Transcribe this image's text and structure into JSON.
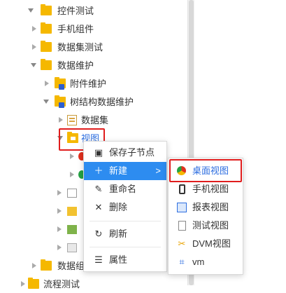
{
  "tree": {
    "items": [
      {
        "label": "控件测试",
        "state": "expanded"
      },
      {
        "label": "手机组件",
        "state": "collapsed"
      },
      {
        "label": "数据集测试",
        "state": "collapsed"
      },
      {
        "label": "数据维护",
        "state": "expanded"
      },
      {
        "label": "附件维护",
        "state": "collapsed"
      },
      {
        "label": "树结构数据维护",
        "state": "expanded"
      },
      {
        "label": "数据集",
        "state": "collapsed"
      },
      {
        "label": "视图",
        "state": "expanded"
      },
      {
        "label": "",
        "state": "collapsed"
      },
      {
        "label": "",
        "state": "collapsed"
      },
      {
        "label": "",
        "state": "collapsed"
      },
      {
        "label": "",
        "state": "collapsed"
      },
      {
        "label": "",
        "state": "collapsed"
      },
      {
        "label": "",
        "state": "collapsed"
      },
      {
        "label": "数据组件",
        "state": "collapsed"
      },
      {
        "label": "流程测试",
        "state": "collapsed"
      }
    ]
  },
  "context_menu": {
    "items": [
      {
        "label": "保存子节点",
        "icon": "save-icon"
      },
      {
        "label": "新建",
        "icon": "plus-icon",
        "active": true
      },
      {
        "label": "重命名",
        "icon": "rename-icon"
      },
      {
        "label": "删除",
        "icon": "close-icon"
      },
      {
        "label": "刷新",
        "icon": "refresh-icon"
      },
      {
        "label": "属性",
        "icon": "properties-icon"
      }
    ],
    "submenu_arrow": ">"
  },
  "submenu": {
    "items": [
      {
        "label": "桌面视图",
        "icon": "chrome-icon",
        "highlighted": true
      },
      {
        "label": "手机视图",
        "icon": "phone-icon"
      },
      {
        "label": "报表视图",
        "icon": "report-icon"
      },
      {
        "label": "测试视图",
        "icon": "document-icon"
      },
      {
        "label": "DVM视图",
        "icon": "dvm-icon"
      },
      {
        "label": "vm",
        "icon": "vm-icon"
      }
    ]
  },
  "colors": {
    "active_bg": "#2d8cf0",
    "highlight_border": "#e01d1d",
    "folder": "#f5b800"
  }
}
